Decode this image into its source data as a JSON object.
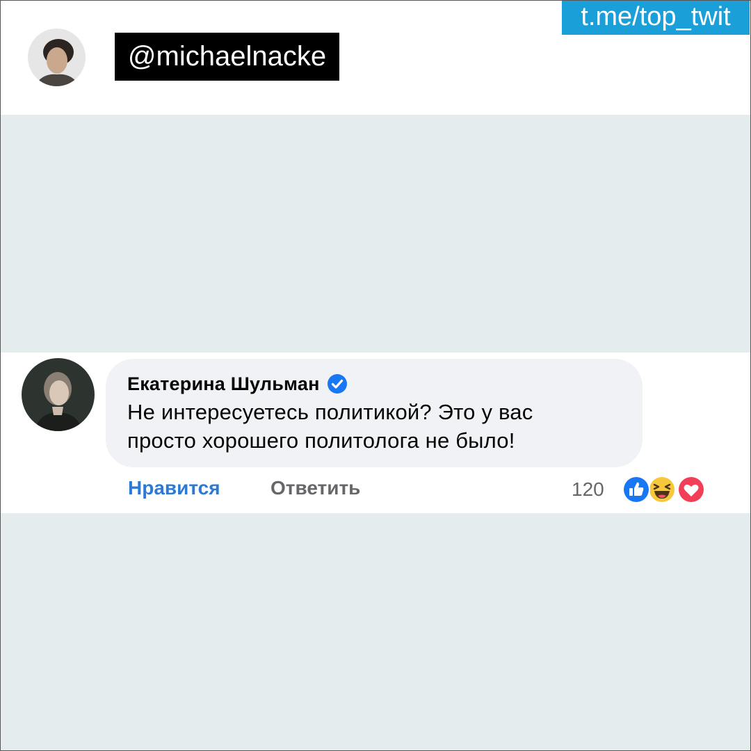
{
  "header": {
    "handle": "@michaelnacke",
    "channel_link": "t.me/top_twit"
  },
  "comment": {
    "author_name": "Екатерина Шульман",
    "verified": true,
    "text_line_1": "Не интересуетесь политикой? Это у вас",
    "text_line_2": "просто хорошего политолога не было!",
    "actions": {
      "like_label": "Нравится",
      "reply_label": "Ответить"
    },
    "reaction_count": "120",
    "reactions": [
      "like-icon",
      "haha-icon",
      "love-icon"
    ]
  },
  "colors": {
    "channel_badge": "#1a9fd8",
    "like_action": "#2d7ad6",
    "verified_badge": "#1877f2",
    "background_gray": "#e4ecee"
  }
}
